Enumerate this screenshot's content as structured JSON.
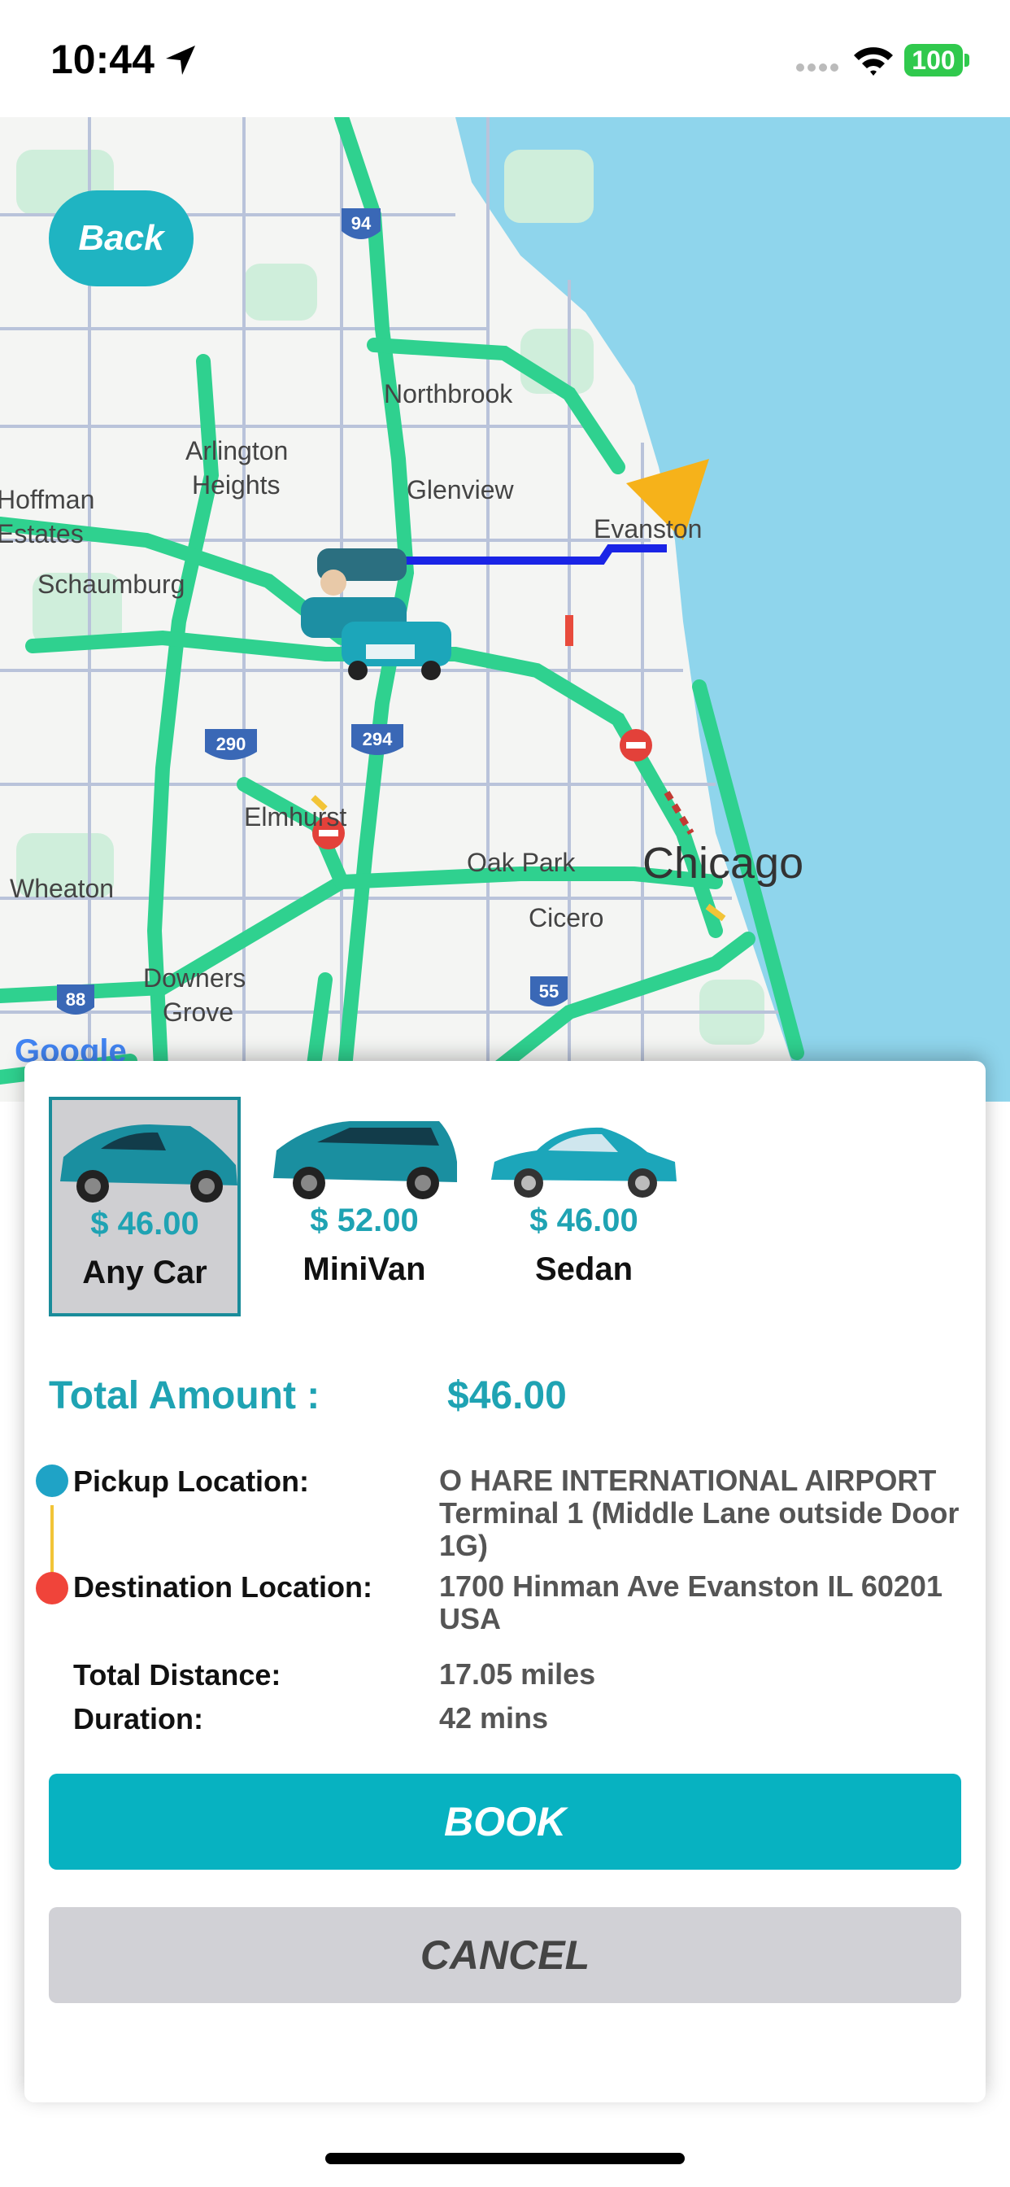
{
  "status_bar": {
    "time": "10:44",
    "battery": "100"
  },
  "colors": {
    "accent": "#07b2c1",
    "map_water": "#8fd5ec",
    "traffic_green": "#2fd18f",
    "route_blue": "#1a24e6",
    "pickup_dot": "#1fa3c6",
    "destination_dot": "#f0443a"
  },
  "map": {
    "back_label": "Back",
    "labels": [
      "Northbrook",
      "Arlington",
      "Heights",
      "Glenview",
      "Hoffman",
      "Estates",
      "Evanston",
      "Schaumburg",
      "Elmhurst",
      "Oak Park",
      "Chicago",
      "Cicero",
      "Wheaton",
      "Downers",
      "Grove"
    ],
    "highway_shields": [
      "94",
      "290",
      "294",
      "88",
      "55"
    ],
    "attribution": "Google"
  },
  "car_options": [
    {
      "price": "$ 46.00",
      "name": "Any Car",
      "selected": true,
      "icon": "hatchback-car-icon"
    },
    {
      "price": "$ 52.00",
      "name": "MiniVan",
      "selected": false,
      "icon": "minivan-car-icon"
    },
    {
      "price": "$ 46.00",
      "name": "Sedan",
      "selected": false,
      "icon": "sedan-car-icon"
    }
  ],
  "summary": {
    "total_label": "Total Amount :",
    "total_value": "$46.00",
    "pickup_label": "Pickup Location:",
    "pickup_value": "O HARE INTERNATIONAL AIRPORT Terminal 1 (Middle Lane outside Door 1G)",
    "destination_label": "Destination Location:",
    "destination_value": "1700 Hinman Ave Evanston IL 60201 USA",
    "distance_label": "Total Distance:",
    "distance_value": "17.05 miles",
    "duration_label": "Duration:",
    "duration_value": "42 mins"
  },
  "actions": {
    "book_label": "BOOK",
    "cancel_label": "CANCEL"
  }
}
